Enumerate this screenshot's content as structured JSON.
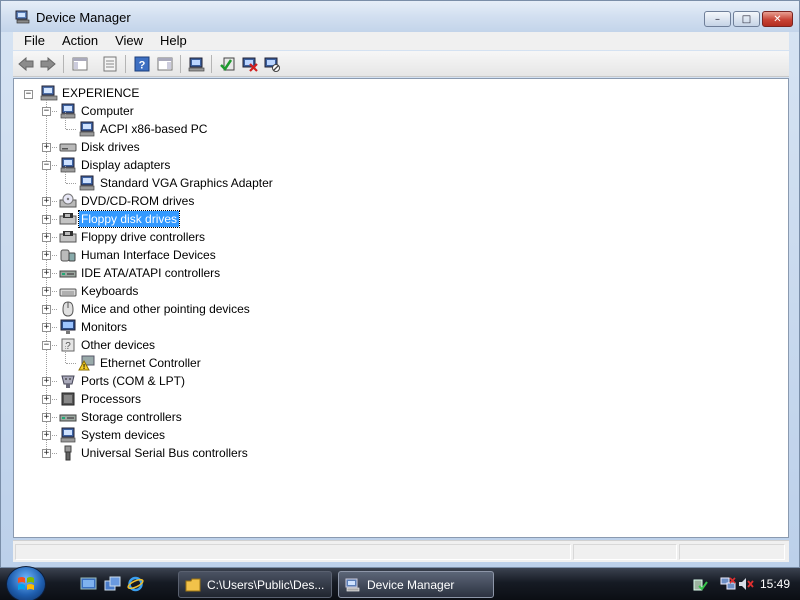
{
  "window": {
    "title": "Device Manager",
    "controls": {
      "minimize": "–",
      "maximize": "□",
      "close": "✕"
    }
  },
  "menu": {
    "items": [
      "File",
      "Action",
      "View",
      "Help"
    ]
  },
  "toolbar": {
    "icons": [
      "back-icon",
      "forward-icon",
      "show-hide-console-tree-icon",
      "properties-icon",
      "help-icon",
      "show-hide-action-pane-icon",
      "scan-hardware-icon",
      "update-driver-icon",
      "uninstall-icon",
      "disable-icon"
    ]
  },
  "tree": {
    "root": "EXPERIENCE",
    "nodes": [
      {
        "label": "Computer",
        "level": 1,
        "expanded": true,
        "icon": "computer-icon"
      },
      {
        "label": "ACPI x86-based PC",
        "level": 2,
        "icon": "computer-icon"
      },
      {
        "label": "Disk drives",
        "level": 1,
        "expanded": false,
        "icon": "disk-drive-icon"
      },
      {
        "label": "Display adapters",
        "level": 1,
        "expanded": true,
        "icon": "display-adapter-icon"
      },
      {
        "label": "Standard VGA Graphics Adapter",
        "level": 2,
        "icon": "display-adapter-icon"
      },
      {
        "label": "DVD/CD-ROM drives",
        "level": 1,
        "expanded": false,
        "icon": "cdrom-icon"
      },
      {
        "label": "Floppy disk drives",
        "level": 1,
        "expanded": false,
        "icon": "floppy-icon",
        "selected": true
      },
      {
        "label": "Floppy drive controllers",
        "level": 1,
        "expanded": false,
        "icon": "floppy-controller-icon"
      },
      {
        "label": "Human Interface Devices",
        "level": 1,
        "expanded": false,
        "icon": "hid-icon"
      },
      {
        "label": "IDE ATA/ATAPI controllers",
        "level": 1,
        "expanded": false,
        "icon": "ide-controller-icon"
      },
      {
        "label": "Keyboards",
        "level": 1,
        "expanded": false,
        "icon": "keyboard-icon"
      },
      {
        "label": "Mice and other pointing devices",
        "level": 1,
        "expanded": false,
        "icon": "mouse-icon"
      },
      {
        "label": "Monitors",
        "level": 1,
        "expanded": false,
        "icon": "monitor-icon"
      },
      {
        "label": "Other devices",
        "level": 1,
        "expanded": true,
        "icon": "other-devices-icon"
      },
      {
        "label": "Ethernet Controller",
        "level": 2,
        "icon": "warning-device-icon"
      },
      {
        "label": "Ports (COM & LPT)",
        "level": 1,
        "expanded": false,
        "icon": "port-icon"
      },
      {
        "label": "Processors",
        "level": 1,
        "expanded": false,
        "icon": "processor-icon"
      },
      {
        "label": "Storage controllers",
        "level": 1,
        "expanded": false,
        "icon": "storage-controller-icon"
      },
      {
        "label": "System devices",
        "level": 1,
        "expanded": false,
        "icon": "system-devices-icon"
      },
      {
        "label": "Universal Serial Bus controllers",
        "level": 1,
        "expanded": false,
        "icon": "usb-icon"
      }
    ]
  },
  "taskbar": {
    "quick_launch": [
      "show-desktop-icon",
      "switch-windows-icon",
      "internet-explorer-icon"
    ],
    "buttons": [
      {
        "label": "C:\\Users\\Public\\Des...",
        "icon": "folder-icon"
      },
      {
        "label": "Device Manager",
        "icon": "device-manager-icon",
        "active": true
      }
    ],
    "tray_icons": [
      "safely-remove-icon",
      "network-icon",
      "volume-muted-icon"
    ],
    "clock": "15:49"
  },
  "colors": {
    "selection": "#3399ff",
    "taskbar": "#161b24",
    "close_button": "#c84335"
  }
}
